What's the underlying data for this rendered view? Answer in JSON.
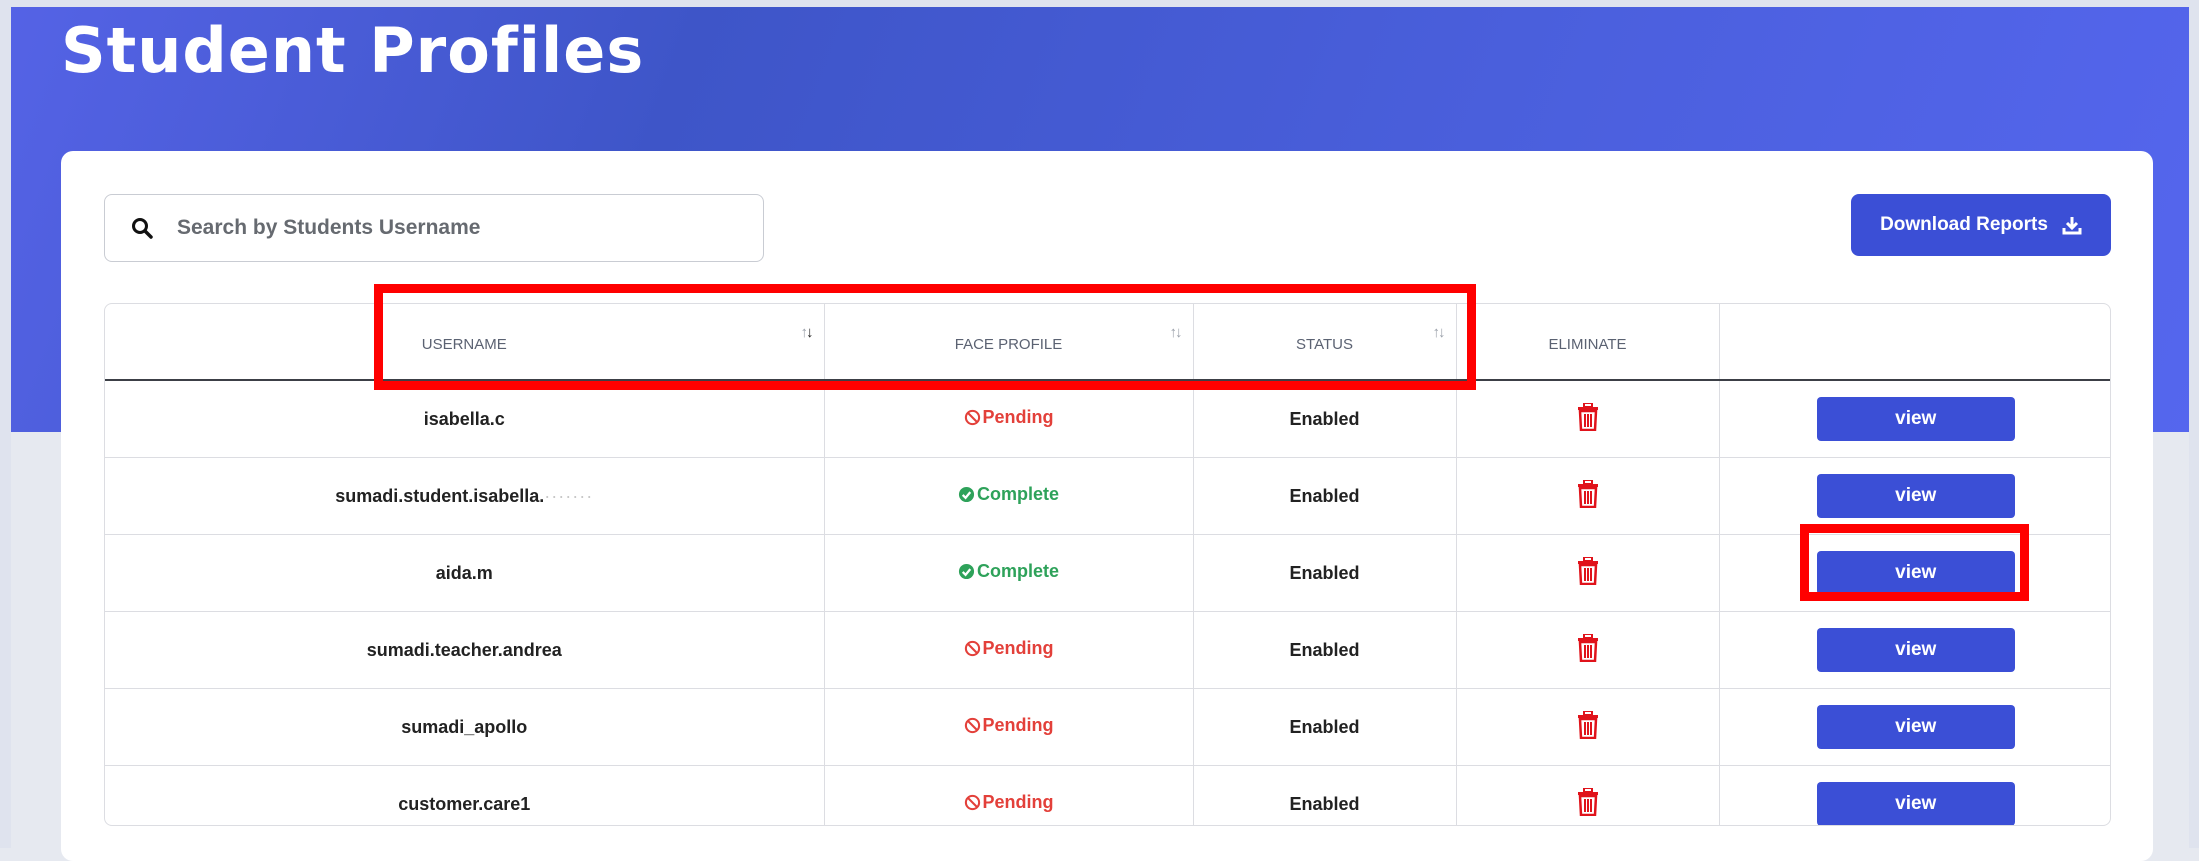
{
  "page": {
    "title": "Student Profiles"
  },
  "search": {
    "placeholder": "Search by Students Username",
    "value": ""
  },
  "toolbar": {
    "download_label": "Download Reports"
  },
  "table": {
    "columns": [
      "USERNAME",
      "FACE PROFILE",
      "STATUS",
      "ELIMINATE",
      ""
    ],
    "rows": [
      {
        "username": "isabella.c",
        "face_profile": "Pending",
        "status": "Enabled",
        "action": "view"
      },
      {
        "username": "sumadi.student.isabella.",
        "face_profile": "Complete",
        "status": "Enabled",
        "action": "view"
      },
      {
        "username": "aida.m",
        "face_profile": "Complete",
        "status": "Enabled",
        "action": "view"
      },
      {
        "username": "sumadi.teacher.andrea",
        "face_profile": "Pending",
        "status": "Enabled",
        "action": "view"
      },
      {
        "username": "sumadi_apollo",
        "face_profile": "Pending",
        "status": "Enabled",
        "action": "view"
      },
      {
        "username": "customer.care1",
        "face_profile": "Pending",
        "status": "Enabled",
        "action": "view"
      }
    ]
  },
  "colors": {
    "primary": "#3b4fd6",
    "pending": "#e3403a",
    "complete": "#2ea25a",
    "delete": "#e0131b",
    "highlight": "#ff0000"
  },
  "icons": {
    "search": "search-icon",
    "download": "download-icon",
    "sort": "sort-icon",
    "delete": "trash-icon",
    "pending": "ban-icon",
    "complete": "check-circle-icon"
  }
}
